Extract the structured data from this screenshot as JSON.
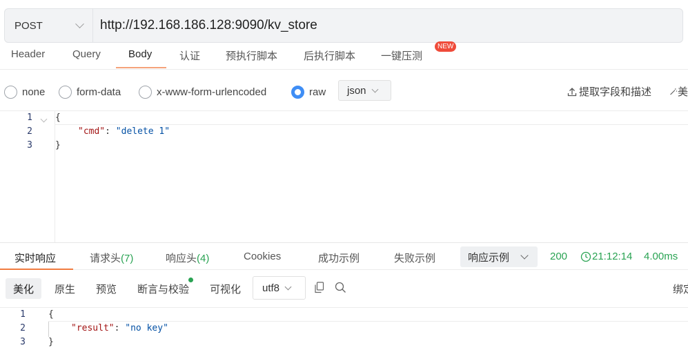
{
  "request": {
    "method": "POST",
    "url": "http://192.168.186.128:9090/kv_store"
  },
  "request_tabs": [
    {
      "label": "Header",
      "active": false
    },
    {
      "label": "Query",
      "active": false
    },
    {
      "label": "Body",
      "active": true
    },
    {
      "label": "认证",
      "active": false
    },
    {
      "label": "预执行脚本",
      "active": false
    },
    {
      "label": "后执行脚本",
      "active": false
    },
    {
      "label": "一键压测",
      "active": false,
      "badge": "NEW"
    }
  ],
  "body_types": [
    {
      "label": "none",
      "checked": false
    },
    {
      "label": "form-data",
      "checked": false
    },
    {
      "label": "x-www-form-urlencoded",
      "checked": false
    },
    {
      "label": "raw",
      "checked": true
    }
  ],
  "raw_format": "json",
  "extract_label": "提取字段和描述",
  "magic_label": "美",
  "request_body": {
    "line_numbers": [
      "1",
      "2",
      "3"
    ],
    "open_brace": "{",
    "key": "\"cmd\"",
    "colon": ": ",
    "value": "\"delete 1\"",
    "close_brace": "}"
  },
  "response_tabs": [
    {
      "label": "实时响应",
      "active": true
    },
    {
      "label": "请求头",
      "count": "(7)"
    },
    {
      "label": "响应头",
      "count": "(4)"
    },
    {
      "label": "Cookies"
    },
    {
      "label": "成功示例"
    },
    {
      "label": "失败示例"
    }
  ],
  "response_example_select": "响应示例",
  "response_status": {
    "code": "200",
    "time": "21:12:14",
    "duration": "4.00ms"
  },
  "response_view_tabs": [
    {
      "label": "美化",
      "active": true
    },
    {
      "label": "原生"
    },
    {
      "label": "预览"
    },
    {
      "label": "断言与校验"
    },
    {
      "label": "可视化"
    }
  ],
  "encoding": "utf8",
  "bind_label": "绑定",
  "response_body": {
    "line_numbers": [
      "1",
      "2",
      "3"
    ],
    "open_brace": "{",
    "key": "\"result\"",
    "colon": ": ",
    "value": "\"no key\"",
    "close_brace": "}"
  },
  "colors": {
    "accent_tab": "#f07b3f",
    "radio_checked": "#3f8ef5",
    "success": "#2aa353",
    "new_badge": "#ef4b3a"
  }
}
